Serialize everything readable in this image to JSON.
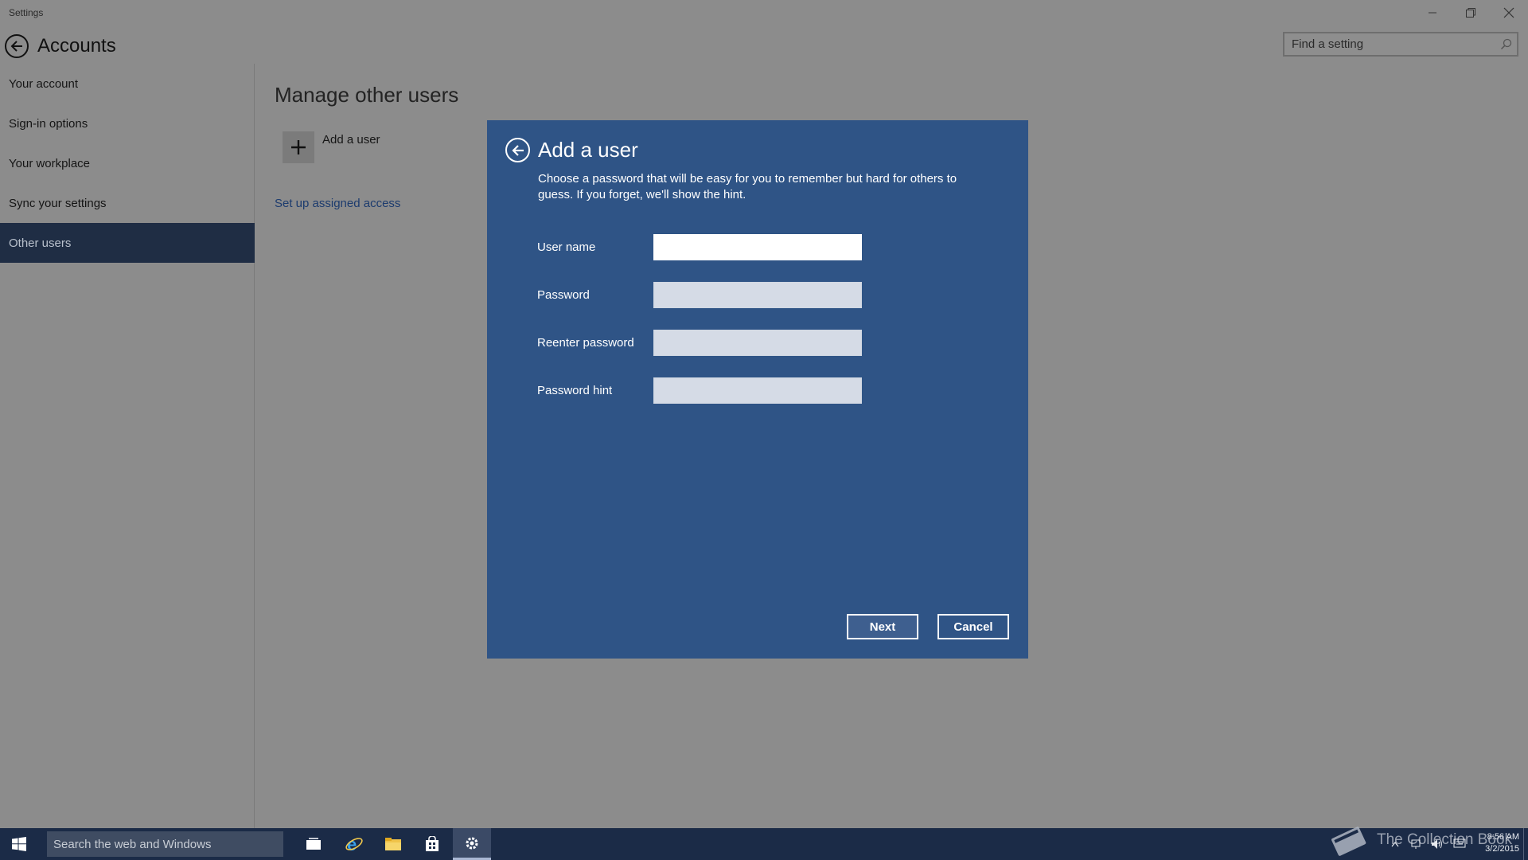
{
  "window": {
    "title": "Settings"
  },
  "header": {
    "title": "Accounts",
    "search_placeholder": "Find a setting"
  },
  "sidebar": {
    "items": [
      {
        "label": "Your account"
      },
      {
        "label": "Sign-in options"
      },
      {
        "label": "Your workplace"
      },
      {
        "label": "Sync your settings"
      },
      {
        "label": "Other users",
        "active": true
      }
    ]
  },
  "main": {
    "section_title": "Manage other users",
    "add_user_label": "Add a user",
    "assigned_access_link": "Set up assigned access"
  },
  "dialog": {
    "title": "Add a user",
    "description": "Choose a password that will be easy for you to remember but hard for others to guess. If you forget, we'll show the hint.",
    "fields": {
      "username_label": "User name",
      "username_value": "",
      "password_label": "Password",
      "reenter_label": "Reenter password",
      "hint_label": "Password hint"
    },
    "next_label": "Next",
    "cancel_label": "Cancel",
    "background_color": "#2f5486"
  },
  "taskbar": {
    "search_placeholder": "Search the web and Windows",
    "apps": [
      "task-view-icon",
      "internet-explorer-icon",
      "file-explorer-icon",
      "store-icon",
      "settings-icon"
    ],
    "watermark": "The Collection Book",
    "clock_time": "8:56 AM",
    "clock_date": "3/2/2015"
  },
  "colors": {
    "accent": "#1f2d44",
    "link": "#1c3b6e",
    "taskbar": "#1b2b47"
  }
}
